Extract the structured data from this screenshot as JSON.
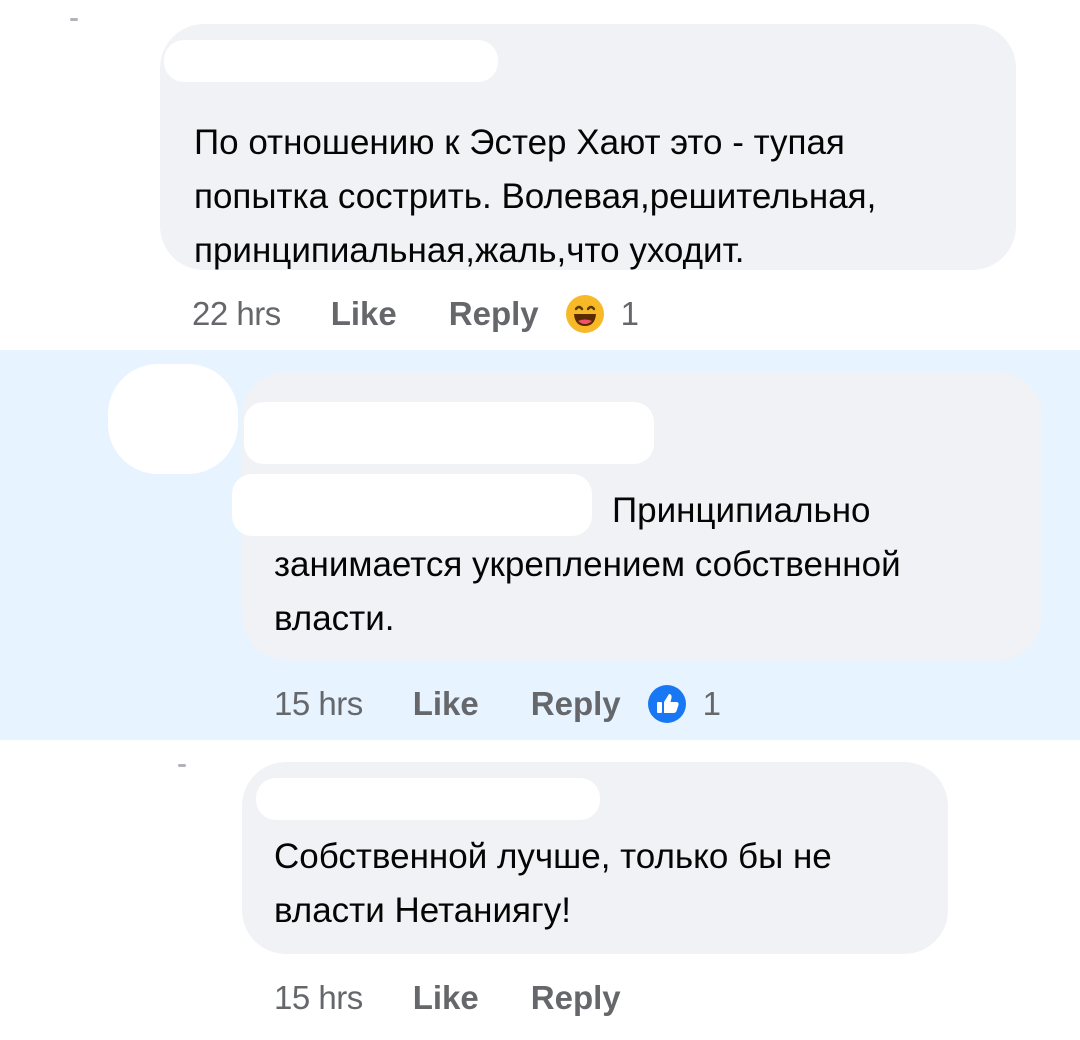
{
  "comments": [
    {
      "text_lines": [
        "По отношению к Эстер Хают это - тупая",
        "попытка сострить. Волевая,решительная,",
        "принципиальная,жаль,что уходит."
      ],
      "time": "22 hrs",
      "like_label": "Like",
      "reply_label": "Reply",
      "reaction_icon": "haha-emoji-icon",
      "reaction_count": "1"
    },
    {
      "text_lines": [
        "Принципиально",
        "занимается укреплением собственной",
        "власти."
      ],
      "time": "15 hrs",
      "like_label": "Like",
      "reply_label": "Reply",
      "reaction_icon": "like-thumbs-up-icon",
      "reaction_count": "1",
      "highlighted": true
    },
    {
      "text_lines": [
        "Собственной лучше, только бы не",
        "власти Нетаниягу!"
      ],
      "time": "15 hrs",
      "like_label": "Like",
      "reply_label": "Reply"
    }
  ],
  "colors": {
    "bubble": "#f0f2f5",
    "highlight": "#e7f3ff",
    "meta_text": "#65676b",
    "like_blue": "#1877f2",
    "haha_yellow": "#f7b928"
  }
}
